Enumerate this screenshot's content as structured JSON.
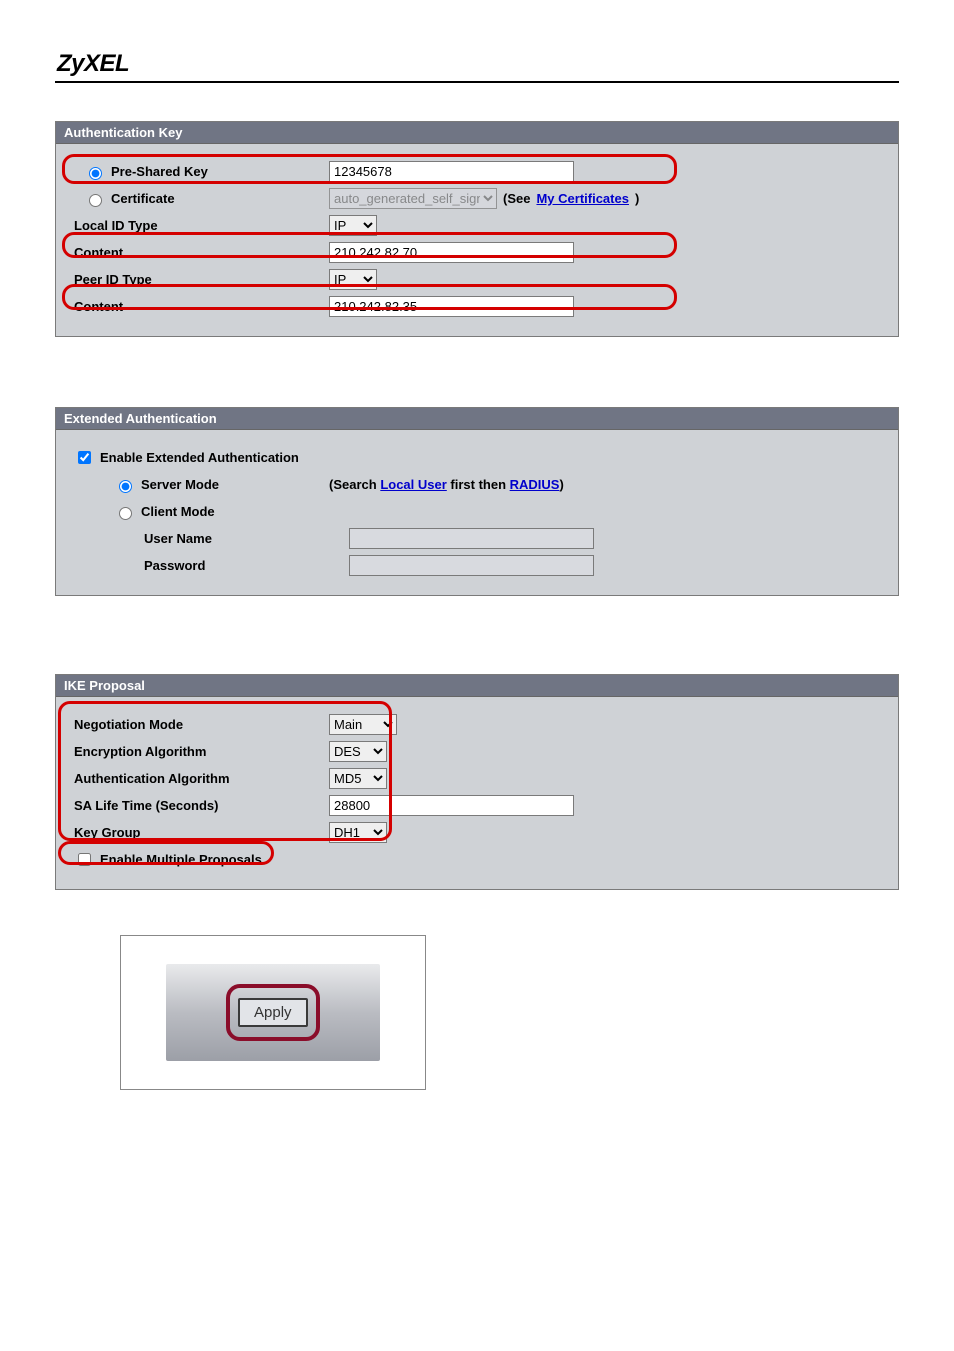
{
  "brand": "ZyXEL",
  "panels": {
    "auth_key": {
      "title": "Authentication Key",
      "psk_label": "Pre-Shared Key",
      "psk_value": "12345678",
      "cert_label": "Certificate",
      "cert_select": "auto_generated_self_signed_cert",
      "cert_see": "(See ",
      "cert_link": "My Certificates",
      "cert_close": ")",
      "local_id_type_label": "Local ID Type",
      "local_id_type_value": "IP",
      "content1_label": "Content",
      "content1_value": "210.242.82.70",
      "peer_id_type_label": "Peer ID Type",
      "peer_id_type_value": "IP",
      "content2_label": "Content",
      "content2_value": "210.242.82.35"
    },
    "ext_auth": {
      "title": "Extended Authentication",
      "enable_label": "Enable Extended Authentication",
      "server_label": "Server Mode",
      "search_pre": "(Search ",
      "search_link1": "Local User",
      "search_mid": " first then ",
      "search_link2": "RADIUS",
      "search_close": ")",
      "client_label": "Client Mode",
      "user_label": "User Name",
      "pass_label": "Password"
    },
    "ike": {
      "title": "IKE Proposal",
      "neg_label": "Negotiation Mode",
      "neg_value": "Main",
      "enc_label": "Encryption Algorithm",
      "enc_value": "DES",
      "authalg_label": "Authentication Algorithm",
      "authalg_value": "MD5",
      "salife_label": "SA Life Time (Seconds)",
      "salife_value": "28800",
      "key_label": "Key Group",
      "key_value": "DH1",
      "multi_label": "Enable Multiple Proposals"
    }
  },
  "apply_label": "Apply"
}
